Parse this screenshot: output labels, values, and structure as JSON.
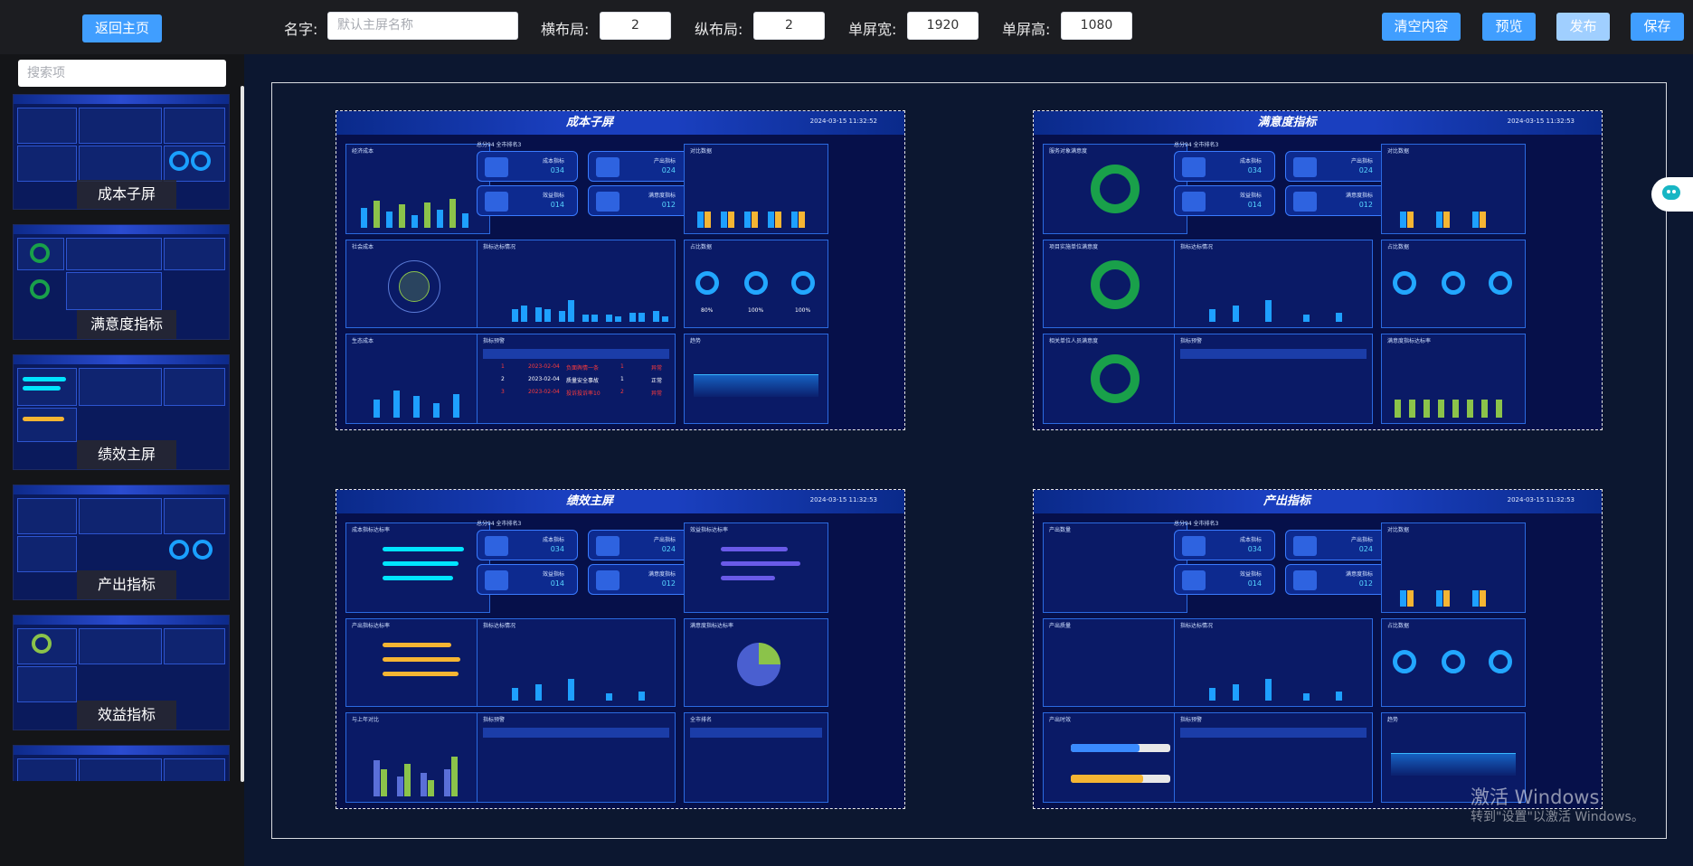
{
  "toolbar": {
    "back_label": "返回主页",
    "name_label": "名字:",
    "name_placeholder": "默认主屏名称",
    "cols_label": "横布局:",
    "cols_value": "2",
    "rows_label": "纵布局:",
    "rows_value": "2",
    "width_label": "单屏宽:",
    "width_value": "1920",
    "height_label": "单屏高:",
    "height_value": "1080",
    "clear_label": "清空内容",
    "preview_label": "预览",
    "publish_label": "发布",
    "save_label": "保存"
  },
  "sidebar": {
    "search_placeholder": "搜索项",
    "items": [
      {
        "label": "成本子屏"
      },
      {
        "label": "满意度指标"
      },
      {
        "label": "绩效主屏"
      },
      {
        "label": "产出指标"
      },
      {
        "label": "效益指标"
      }
    ]
  },
  "screens": [
    {
      "title": "成本子屏",
      "time": "2024-03-15 11:32:52"
    },
    {
      "title": "满意度指标",
      "time": "2024-03-15 11:32:53"
    },
    {
      "title": "绩效主屏",
      "time": "2024-03-15 11:32:53"
    },
    {
      "title": "产出指标",
      "time": "2024-03-15 11:32:53"
    }
  ],
  "widgets": {
    "kpis": [
      {
        "name": "成本指标",
        "value": "034"
      },
      {
        "name": "产出指标",
        "value": "024"
      },
      {
        "name": "效益指标",
        "value": "014"
      },
      {
        "name": "满意度指标",
        "value": "012"
      }
    ],
    "panel_titles": {
      "economic_cost": "经济成本",
      "social_cost": "社会成本",
      "eco_cost": "生态成本",
      "indicator_status": "指标达标情况",
      "indicator_warning": "指标预警",
      "compare": "对比数据",
      "ratio": "占比数据",
      "trend": "趋势",
      "satisfaction_service": "服务对象满意度",
      "satisfaction_unit": "项目实施单位满意度",
      "satisfaction_staff": "相关单位人员满意度",
      "cost_rate": "成本指标达标率",
      "output_rate": "产出指标达标率",
      "benefit_rate": "效益指标达标率",
      "satisfaction_rate": "满意度指标达标率",
      "yoy": "与上年对比",
      "city_rank": "全市排名",
      "output_qty": "产出数量",
      "output_quality": "产出质量",
      "output_timely": "产出时效"
    },
    "table_rows": [
      {
        "no": "1",
        "date": "2023-02-04",
        "name": "负面舆情一条",
        "level": "1",
        "status": "异常"
      },
      {
        "no": "2",
        "date": "2023-02-04",
        "name": "质量安全事故",
        "level": "1",
        "status": "正常"
      },
      {
        "no": "3",
        "date": "2023-02-04",
        "name": "投诉投诉率10",
        "level": "2",
        "status": "异常"
      }
    ],
    "ring_labels": [
      "80%",
      "100%",
      "100%"
    ],
    "score_line": "总分94  全市排名3"
  },
  "watermark": {
    "line1": "激活 Windows",
    "line2": "转到\"设置\"以激活 Windows。"
  },
  "colors": {
    "accent": "#409eff",
    "accent_disabled": "#a0cfff",
    "screen_bg": "#06104a",
    "panel_border": "#2b6ae0",
    "bar_blue": "#1ea0ff",
    "bar_yellow": "#f5b533",
    "donut_green": "#19a04a"
  }
}
